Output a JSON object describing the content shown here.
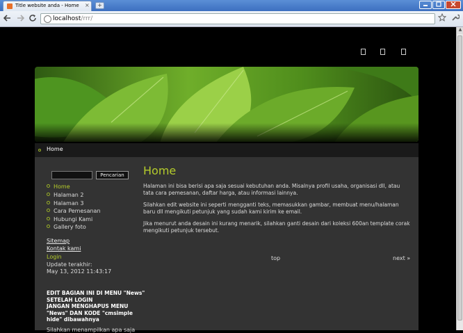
{
  "browser": {
    "tab_title": "Title website anda - Home",
    "tab_close": "×",
    "new_tab": "+",
    "url_host": "localhost",
    "url_path": "/rrr/"
  },
  "nav": {
    "home": "Home"
  },
  "search": {
    "button_label": "Pencarian"
  },
  "menu": [
    "Home",
    "Halaman 2",
    "Halaman 3",
    "Cara Pemesanan",
    "Hubungi Kami",
    "Gallery foto"
  ],
  "sidebar": {
    "sitemap": "Sitemap",
    "contact": "Kontak kami",
    "login": "Login",
    "update_label": "Update terakhir:",
    "update_date": "May 13, 2012 11:43:17",
    "bold_lines": [
      "EDIT BAGIAN INI DI MENU \"News\"",
      "SETELAH LOGIN",
      "JANGAN MENGHAPUS MENU",
      "\"News\" DAN KODE \"cmsimple",
      "hide\" dibawahnya"
    ],
    "partial_text": "Silahkan menampilkan apa saja"
  },
  "main": {
    "title": "Home",
    "paragraphs": [
      "Halaman ini bisa berisi apa saja sesuai kebutuhan anda. Misalnya profil usaha, organisasi dll, atau tata cara pemesanan, daftar harga, atau informasi lainnya.",
      "Silahkan edit website ini seperti mengganti teks, memasukkan gambar, membuat menu/halaman baru dll mengikuti petunjuk yang sudah kami kirim ke email.",
      "Jika menurut anda desain ini kurang menarik, silahkan ganti desain dari koleksi 600an template corak mengikuti petunjuk tersebut."
    ],
    "top_link": "top",
    "next_link": "next »"
  },
  "colors": {
    "accent": "#b5cc2b",
    "content_bg": "#333333",
    "page_bg": "#000000"
  }
}
